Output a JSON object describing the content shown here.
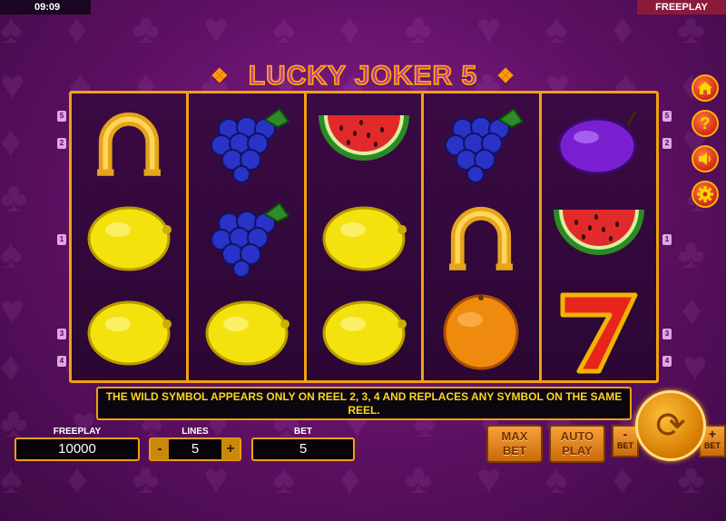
{
  "status_bar": {
    "time": "09:09",
    "mode": "FREEPLAY"
  },
  "title": "LUCKY JOKER 5",
  "side_buttons": [
    {
      "icon": "home-icon"
    },
    {
      "icon": "help-icon",
      "glyph": "?"
    },
    {
      "icon": "sound-icon"
    },
    {
      "icon": "settings-icon"
    }
  ],
  "line_markers_left": [
    "5",
    "2",
    "1",
    "3",
    "4"
  ],
  "line_markers_right": [
    "5",
    "2",
    "1",
    "3",
    "4"
  ],
  "reels": [
    [
      "horseshoe",
      "lemon",
      "lemon"
    ],
    [
      "grapes",
      "grapes",
      "lemon"
    ],
    [
      "watermelon",
      "lemon",
      "lemon"
    ],
    [
      "grapes",
      "horseshoe",
      "orange"
    ],
    [
      "plum",
      "watermelon",
      "seven"
    ]
  ],
  "info_message": "THE WILD SYMBOL APPEARS ONLY ON REEL 2, 3, 4 AND REPLACES ANY SYMBOL ON THE SAME REEL.",
  "freeplay": {
    "label": "FREEPLAY",
    "value": "10000"
  },
  "lines": {
    "label": "LINES",
    "value": "5",
    "minus": "-",
    "plus": "+"
  },
  "bet": {
    "label": "BET",
    "value": "5"
  },
  "buttons": {
    "max_bet": [
      "MAX",
      "BET"
    ],
    "auto_play": [
      "AUTO",
      "PLAY"
    ],
    "bet_minus": "-",
    "bet_minus_label": "BET",
    "bet_plus": "+",
    "bet_plus_label": "BET"
  }
}
